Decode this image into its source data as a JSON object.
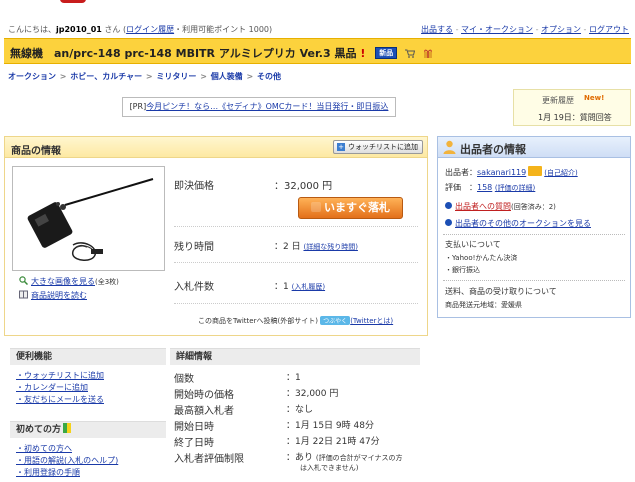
{
  "header": {
    "greeting_prefix": "こんにちは、",
    "user_name": "jp2010_01",
    "greeting_suffix": "さん",
    "login_history": "ログイン履歴",
    "points": "・利用可能ポイント 1000",
    "links": [
      "出品する",
      "マイ・オークション",
      "オプション",
      "ログアウト"
    ]
  },
  "title": {
    "prefix": "無線機",
    "text": "an/prc-148 prc-148 MBITR アルミレプリカ Ver.3 黒品",
    "new_badge": "新品"
  },
  "breadcrumb": [
    "オークション",
    "ホビー、カルチャー",
    "ミリタリー",
    "個人装備",
    "その他"
  ],
  "pr": {
    "tag": "[PR]",
    "text": "今月ピンチ！なら…《セディナ》OMCカード！当日発行・即日振込"
  },
  "history": {
    "label": "更新履歴",
    "new": "New!",
    "entry": "1月 19日：質問回答"
  },
  "product": {
    "heading": "商品の情報",
    "watch_button": "ウォッチリストに追加",
    "view_large": "大きな画像を見る",
    "view_large_count": "(全3枚)",
    "read_description": "商品説明を読む",
    "buyout_label": "即決価格",
    "buyout_value": "：32,000 円",
    "buy_now": "いますぐ落札",
    "time_left_label": "残り時間",
    "time_left_value": "：2 日",
    "time_left_detail": "(詳細な残り時間)",
    "bids_label": "入札件数",
    "bids_value": "：1",
    "bids_history": "(入札履歴)",
    "tweet_text": "この商品をTwitterへ投稿(外部サイト)",
    "tweet_badge": "つぶやく",
    "tweet_what": "(Twitterとは)"
  },
  "seller": {
    "heading": "出品者の情報",
    "seller_label": "出品者：",
    "seller_name": "sakanari119",
    "self_intro": "(自己紹介)",
    "rating_label": "評価　：",
    "rating_value": "158",
    "rating_detail": "(評価の詳細)",
    "question": "出品者への質問",
    "question_count": "(回答済み：2)",
    "other_auctions": "出品者のその他のオークションを見る",
    "payment_heading": "支払いについて",
    "payment_methods": [
      "Yahoo!かんたん決済",
      "銀行振込"
    ],
    "shipping_heading": "送料、商品の受け取りについて",
    "shipping_region": "商品発送元地域：愛媛県"
  },
  "features": {
    "heading": "便利機能",
    "items": [
      "ウォッチリストに追加",
      "カレンダーに追加",
      "友だちにメールを送る"
    ]
  },
  "beginner": {
    "heading": "初めての方",
    "items": [
      "初めての方へ",
      "用語の解説(入札のヘルプ)",
      "利用登録の手順"
    ]
  },
  "details": {
    "heading": "詳細情報",
    "rows": [
      {
        "label": "個数",
        "value": "：1"
      },
      {
        "label": "開始時の価格",
        "value": "：32,000 円"
      },
      {
        "label": "最高額入札者",
        "value": "：なし"
      },
      {
        "label": "開始日時",
        "value": "：1月 15日 9時 48分"
      },
      {
        "label": "終了日時",
        "value": "：1月 22日 21時 47分"
      },
      {
        "label": "入札者評価制限",
        "value": "：あり",
        "note1": "(評価の合計がマイナスの方",
        "note2": "は入札できません)"
      }
    ]
  },
  "colors": {
    "accent": "#fcd23d",
    "link": "#1a3aa8",
    "buy_button": "#e3701a",
    "seller_panel": "#cfdef5"
  }
}
